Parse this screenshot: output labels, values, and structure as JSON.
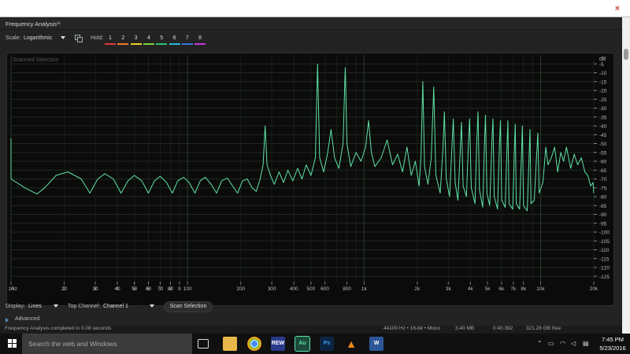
{
  "panel": {
    "title": "Frequency Analysis",
    "menu_icon": "hamburger-menu-icon"
  },
  "toolbar": {
    "scale_label": "Scale:",
    "scale_value": "Logarithmic",
    "copy_icon": "copy-to-clipboard-icon",
    "hold_label": "Hold:",
    "hold_buttons": [
      {
        "label": "1",
        "color": "#e23b3b"
      },
      {
        "label": "2",
        "color": "#f07a2a"
      },
      {
        "label": "3",
        "color": "#e8d22a"
      },
      {
        "label": "4",
        "color": "#7ed23a"
      },
      {
        "label": "5",
        "color": "#2ac870"
      },
      {
        "label": "6",
        "color": "#2ab8d8"
      },
      {
        "label": "7",
        "color": "#3a74e0"
      },
      {
        "label": "8",
        "color": "#c43ad8"
      }
    ]
  },
  "chart_data": {
    "type": "line",
    "title": "Scanned Selection",
    "x_scale": "log",
    "x_unit_label": "Hz",
    "xlim": [
      10,
      20000
    ],
    "x_ticks": [
      "Hz",
      "2",
      "3",
      "4",
      "5",
      "6",
      "7",
      "8",
      "9",
      "10",
      "20",
      "30",
      "40",
      "50",
      "60",
      "70",
      "80",
      "100",
      "200",
      "300",
      "400",
      "500",
      "600",
      "800",
      "1k",
      "2k",
      "3k",
      "4k",
      "5k",
      "6k",
      "7k",
      "8k",
      "10k",
      "20k"
    ],
    "x_tick_values": [
      10,
      2,
      3,
      4,
      5,
      6,
      7,
      8,
      9,
      10,
      20,
      30,
      40,
      50,
      60,
      70,
      80,
      100,
      200,
      300,
      400,
      500,
      600,
      800,
      1000,
      2000,
      3000,
      4000,
      5000,
      6000,
      7000,
      8000,
      10000,
      20000
    ],
    "y_unit_label": "dB",
    "ylim": [
      -128,
      0
    ],
    "y_ticks": [
      -5,
      -10,
      -15,
      -20,
      -25,
      -30,
      -35,
      -40,
      -45,
      -50,
      -55,
      -60,
      -65,
      -70,
      -75,
      -80,
      -85,
      -90,
      -95,
      -100,
      -105,
      -110,
      -115,
      -120,
      -125
    ],
    "series": [
      {
        "name": "Channel 1",
        "color": "#5fe3a6",
        "points": [
          [
            1,
            -47
          ],
          [
            1.5,
            -47.5
          ],
          [
            2,
            -49
          ],
          [
            2.5,
            -53
          ],
          [
            3,
            -57
          ],
          [
            3.5,
            -58
          ],
          [
            5,
            -57.5
          ],
          [
            7,
            -58
          ],
          [
            8,
            -60
          ],
          [
            9,
            -65
          ],
          [
            10,
            -70
          ],
          [
            12,
            -75
          ],
          [
            14,
            -78.5
          ],
          [
            15.5,
            -75
          ],
          [
            18,
            -68
          ],
          [
            21,
            -66
          ],
          [
            25,
            -70
          ],
          [
            28,
            -78
          ],
          [
            31,
            -70
          ],
          [
            34,
            -67
          ],
          [
            38,
            -70
          ],
          [
            42,
            -78
          ],
          [
            46,
            -71
          ],
          [
            50,
            -68
          ],
          [
            55,
            -71
          ],
          [
            60,
            -78
          ],
          [
            65,
            -71
          ],
          [
            70,
            -68.5
          ],
          [
            76,
            -72
          ],
          [
            82,
            -78
          ],
          [
            88,
            -71
          ],
          [
            95,
            -69
          ],
          [
            102,
            -72
          ],
          [
            110,
            -78
          ],
          [
            118,
            -71
          ],
          [
            126,
            -69
          ],
          [
            136,
            -73
          ],
          [
            146,
            -78
          ],
          [
            156,
            -71
          ],
          [
            168,
            -69.5
          ],
          [
            180,
            -74
          ],
          [
            192,
            -78
          ],
          [
            205,
            -71
          ],
          [
            218,
            -70
          ],
          [
            232,
            -75
          ],
          [
            245,
            -77
          ],
          [
            258,
            -70
          ],
          [
            268,
            -62
          ],
          [
            275,
            -40
          ],
          [
            282,
            -62
          ],
          [
            295,
            -68
          ],
          [
            310,
            -73
          ],
          [
            330,
            -66
          ],
          [
            350,
            -72
          ],
          [
            370,
            -65
          ],
          [
            395,
            -71
          ],
          [
            420,
            -64
          ],
          [
            445,
            -70
          ],
          [
            470,
            -62
          ],
          [
            500,
            -68
          ],
          [
            530,
            -58
          ],
          [
            545,
            -5
          ],
          [
            560,
            -58
          ],
          [
            590,
            -66
          ],
          [
            620,
            -56
          ],
          [
            650,
            -42
          ],
          [
            680,
            -58
          ],
          [
            720,
            -64
          ],
          [
            760,
            -50
          ],
          [
            782,
            -7
          ],
          [
            800,
            -50
          ],
          [
            840,
            -63
          ],
          [
            900,
            -55
          ],
          [
            960,
            -60
          ],
          [
            1020,
            -52
          ],
          [
            1060,
            -37
          ],
          [
            1100,
            -55
          ],
          [
            1150,
            -63
          ],
          [
            1250,
            -58
          ],
          [
            1350,
            -48
          ],
          [
            1450,
            -62
          ],
          [
            1550,
            -56
          ],
          [
            1650,
            -66
          ],
          [
            1750,
            -52
          ],
          [
            1850,
            -68
          ],
          [
            1950,
            -60
          ],
          [
            2050,
            -74
          ],
          [
            2100,
            -57
          ],
          [
            2150,
            -15
          ],
          [
            2200,
            -63
          ],
          [
            2300,
            -73
          ],
          [
            2400,
            -58
          ],
          [
            2480,
            -18
          ],
          [
            2550,
            -68
          ],
          [
            2700,
            -78
          ],
          [
            2800,
            -52
          ],
          [
            2850,
            -32
          ],
          [
            2920,
            -70
          ],
          [
            3050,
            -80
          ],
          [
            3150,
            -50
          ],
          [
            3200,
            -36
          ],
          [
            3280,
            -72
          ],
          [
            3400,
            -82
          ],
          [
            3500,
            -55
          ],
          [
            3560,
            -38
          ],
          [
            3640,
            -74
          ],
          [
            3800,
            -80
          ],
          [
            3900,
            -50
          ],
          [
            3960,
            -36
          ],
          [
            4050,
            -75
          ],
          [
            4250,
            -84
          ],
          [
            4350,
            -48
          ],
          [
            4420,
            -32
          ],
          [
            4500,
            -76
          ],
          [
            4700,
            -86
          ],
          [
            4800,
            -52
          ],
          [
            4870,
            -34
          ],
          [
            4960,
            -78
          ],
          [
            5150,
            -85
          ],
          [
            5300,
            -48
          ],
          [
            5370,
            -36
          ],
          [
            5460,
            -80
          ],
          [
            5700,
            -87
          ],
          [
            5850,
            -50
          ],
          [
            5920,
            -37
          ],
          [
            6020,
            -82
          ],
          [
            6300,
            -86
          ],
          [
            6450,
            -52
          ],
          [
            6520,
            -37
          ],
          [
            6620,
            -84
          ],
          [
            6950,
            -87
          ],
          [
            7100,
            -54
          ],
          [
            7180,
            -39
          ],
          [
            7280,
            -84
          ],
          [
            7600,
            -87
          ],
          [
            7800,
            -55
          ],
          [
            7880,
            -40
          ],
          [
            8000,
            -85
          ],
          [
            8400,
            -88
          ],
          [
            8600,
            -58
          ],
          [
            8700,
            -42
          ],
          [
            8820,
            -84
          ],
          [
            9200,
            -82
          ],
          [
            9500,
            -56
          ],
          [
            9650,
            -44
          ],
          [
            9800,
            -78
          ],
          [
            10300,
            -72
          ],
          [
            10700,
            -52
          ],
          [
            11000,
            -62
          ],
          [
            11500,
            -58
          ],
          [
            12000,
            -52
          ],
          [
            12500,
            -66
          ],
          [
            13000,
            -55
          ],
          [
            13500,
            -60
          ],
          [
            14000,
            -52
          ],
          [
            14800,
            -64
          ],
          [
            15500,
            -56
          ],
          [
            16200,
            -62
          ],
          [
            17000,
            -58
          ],
          [
            17800,
            -66
          ],
          [
            18500,
            -68
          ],
          [
            19200,
            -74
          ],
          [
            19800,
            -72
          ],
          [
            20000,
            -78
          ]
        ]
      }
    ],
    "grid": true
  },
  "controls": {
    "display_label": "Display:",
    "display_value": "Lines",
    "top_channel_label": "Top Channel:",
    "top_channel_value": "Channel 1",
    "scan_button": "Scan Selection",
    "advanced_label": "Advanced"
  },
  "statusbar": {
    "message": "Frequency Analysis completed in 0.08 seconds",
    "format": "44100 Hz • 16-bit • Mono",
    "size": "3.40 MB",
    "duration": "0:40.392",
    "free_space": "321.28 GB free"
  },
  "taskbar": {
    "search_placeholder": "Search the web and Windows",
    "apps": [
      {
        "name": "task-view-icon",
        "label": "",
        "color": "#101010"
      },
      {
        "name": "file-explorer-icon",
        "label": "",
        "color": "#e8b84a"
      },
      {
        "name": "chrome-icon",
        "label": "",
        "color": "#d94a3a"
      },
      {
        "name": "rew-icon",
        "label": "REW",
        "color": "#2a3a8a"
      },
      {
        "name": "audition-icon",
        "label": "Au",
        "color": "#1d4a3c"
      },
      {
        "name": "photoshop-icon",
        "label": "Ps",
        "color": "#0d2540"
      },
      {
        "name": "vlc-icon",
        "label": "",
        "color": "#101010"
      },
      {
        "name": "word-icon",
        "label": "W",
        "color": "#2b5797"
      }
    ],
    "time": "7:45 PM",
    "date": "5/23/2016"
  }
}
